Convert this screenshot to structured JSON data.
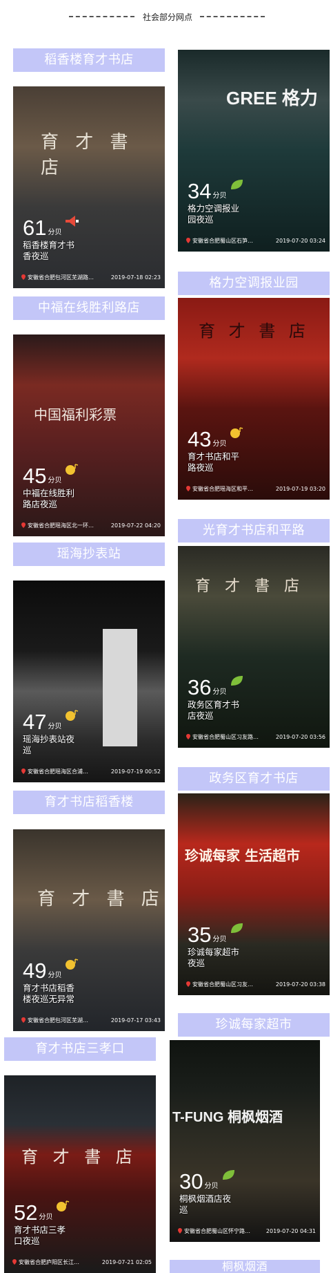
{
  "header": {
    "title": "社会部分网点"
  },
  "labels": [
    "稻香楼育才书店",
    "格力空调报业园",
    "中福在线胜利路店",
    "光育才书店和平路",
    "瑶海抄表站",
    "政务区育才书店",
    "育才书店稻香楼",
    "珍诚每家超市",
    "育才书店三孝口",
    "桐枫烟酒"
  ],
  "score_unit": "分贝",
  "cards": [
    {
      "score": "61",
      "desc": "稻香楼育才书香夜巡",
      "addr": "安徽省合肥包河区芜湖路…",
      "time": "2019-07-18 02:23",
      "badge": "speaker-icon",
      "sign": "育 才 書 店"
    },
    {
      "score": "34",
      "desc": "格力空调报业园夜巡",
      "addr": "安徽省合肥蜀山区石笋…",
      "time": "2019-07-20 03:24",
      "badge": "leaf-icon",
      "sign": "GREE 格力"
    },
    {
      "score": "45",
      "desc": "中福在线胜利路店夜巡",
      "addr": "安徽省合肥瑶海区北一环…",
      "time": "2019-07-22 04:20",
      "badge": "moon-note-icon",
      "sign": "中国福利彩票"
    },
    {
      "score": "43",
      "desc": "育才书店和平路夜巡",
      "addr": "安徽省合肥瑶海区和平…",
      "time": "2019-07-19 03:20",
      "badge": "moon-note-icon",
      "sign": "育 才 書 店"
    },
    {
      "score": "47",
      "desc": "瑶海抄表站夜巡",
      "addr": "安徽省合肥瑶海区合浦…",
      "time": "2019-07-19 00:52",
      "badge": "moon-note-icon",
      "sign": ""
    },
    {
      "score": "36",
      "desc": "政务区育才书店夜巡",
      "addr": "安徽省合肥蜀山区习友路…",
      "time": "2019-07-20 03:56",
      "badge": "leaf-icon",
      "sign": "育 才 書 店"
    },
    {
      "score": "49",
      "desc": "育才书店稻香楼夜巡无异常",
      "addr": "安徽省合肥包河区芜湖…",
      "time": "2019-07-17 03:43",
      "badge": "moon-note-icon",
      "sign": "育 才 書 店"
    },
    {
      "score": "35",
      "desc": "珍诚每家超市夜巡",
      "addr": "安徽省合肥蜀山区习友…",
      "time": "2019-07-20 03:38",
      "badge": "leaf-icon",
      "sign": "珍诚每家 生活超市"
    },
    {
      "score": "52",
      "desc": "育才书店三孝口夜巡",
      "addr": "安徽省合肥庐阳区长江…",
      "time": "2019-07-21 02:05",
      "badge": "moon-note-icon",
      "sign": "育 才 書 店"
    },
    {
      "score": "30",
      "desc": "桐枫烟酒店夜巡",
      "addr": "安徽省合肥蜀山区怀宁路…",
      "time": "2019-07-20 04:31",
      "badge": "leaf-icon",
      "sign": "T-FUNG 桐枫烟酒"
    }
  ]
}
